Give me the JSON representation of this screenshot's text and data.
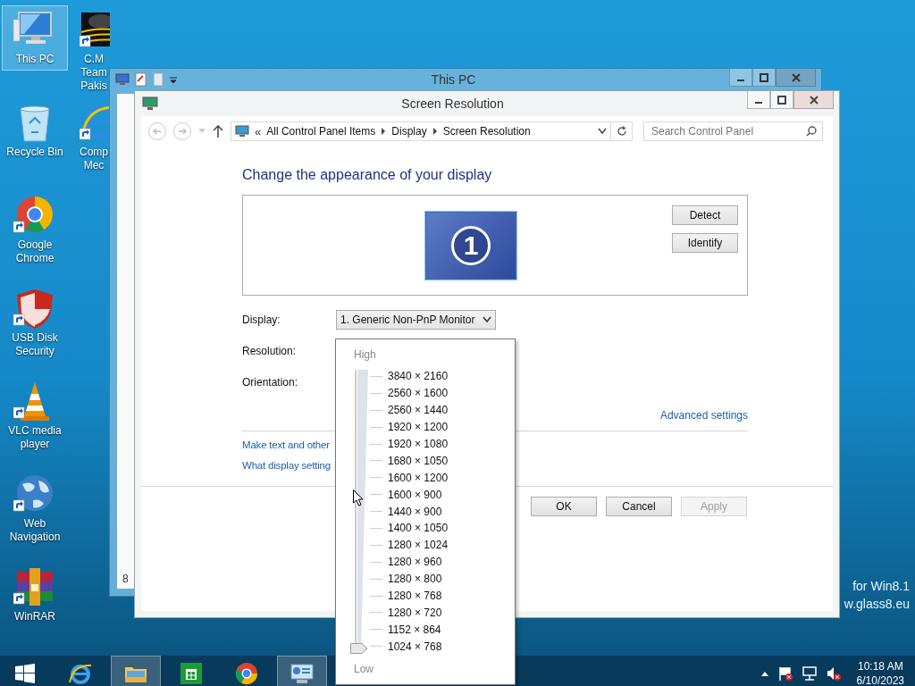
{
  "desktop": {
    "icons": [
      {
        "label": "This PC",
        "kind": "pc",
        "selected": true
      },
      {
        "label": "Recycle Bin",
        "kind": "recycle",
        "selected": false
      },
      {
        "label": "Google Chrome",
        "kind": "chrome",
        "selected": false
      },
      {
        "label": "USB Disk Security",
        "kind": "shield",
        "selected": false
      },
      {
        "label": "VLC media player",
        "kind": "cone",
        "selected": false
      },
      {
        "label": "Web Navigation",
        "kind": "globe",
        "selected": false
      },
      {
        "label": "WinRAR",
        "kind": "archive",
        "selected": false
      },
      {
        "label": "C.M Team Pakis",
        "kind": "cm",
        "selected": false
      },
      {
        "label": "Comp Mec",
        "kind": "ie",
        "selected": false
      }
    ],
    "overlay_text": [
      "for Win8.1",
      "w.glass8.eu"
    ]
  },
  "back_window": {
    "title": "This PC",
    "fragment": "8"
  },
  "window": {
    "title": "Screen Resolution",
    "address_prefix": "«",
    "breadcrumb": [
      "All Control Panel Items",
      "Display",
      "Screen Resolution"
    ],
    "search": {
      "placeholder": "Search Control Panel"
    },
    "heading": "Change the appearance of your display",
    "monitor": {
      "number": "1"
    },
    "preview_buttons": [
      "Detect",
      "Identify"
    ],
    "fields": [
      {
        "label": "Display:",
        "value": "1. Generic Non-PnP Monitor"
      },
      {
        "label": "Resolution:"
      },
      {
        "label": "Orientation:"
      }
    ],
    "advanced_link": "Advanced settings",
    "links": [
      "Make text and other",
      "What display setting"
    ],
    "buttons": [
      {
        "label": "OK",
        "disabled": false
      },
      {
        "label": "Cancel",
        "disabled": false
      },
      {
        "label": "Apply",
        "disabled": true
      }
    ]
  },
  "resolution_popup": {
    "high_label": "High",
    "low_label": "Low",
    "level": 0,
    "options": [
      "3840 × 2160",
      "2560 × 1600",
      "2560 × 1440",
      "1920 × 1200",
      "1920 × 1080",
      "1680 × 1050",
      "1600 × 1200",
      "1600 × 900",
      "1440 × 900",
      "1400 × 1050",
      "1280 × 1024",
      "1280 × 960",
      "1280 × 800",
      "1280 × 768",
      "1280 × 720",
      "1152 × 864",
      "1024 × 768"
    ]
  },
  "taskbar": {
    "apps": [
      {
        "kind": "start",
        "active": false
      },
      {
        "kind": "ie",
        "active": false
      },
      {
        "kind": "explorer",
        "active": true
      },
      {
        "kind": "store",
        "active": false
      },
      {
        "kind": "chrome",
        "active": false
      },
      {
        "kind": "control",
        "active": true
      }
    ],
    "time": "10:18 AM",
    "date": "6/10/2023"
  }
}
